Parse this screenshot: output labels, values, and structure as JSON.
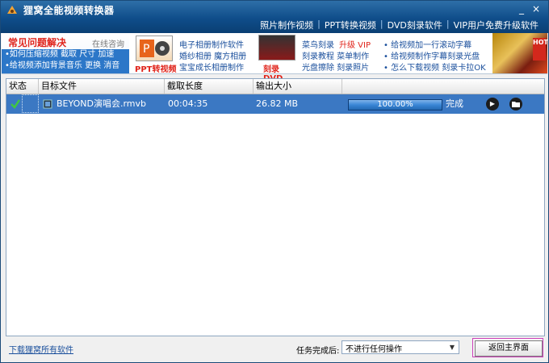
{
  "titlebar": {
    "title": "狸窝全能视频转换器",
    "minimize": "_",
    "close": "×",
    "nav": [
      "照片制作视频",
      "PPT转换视频",
      "DVD刻录软件",
      "VIP用户免费升级软件"
    ]
  },
  "banner": {
    "faq_title": "常见问题解决",
    "faq_online": "在线咨询",
    "faq_line1": "•如何压缩视频  截取  尺寸  加速",
    "faq_line2": "•给视频添加背景音乐  更换  消音",
    "ppt_label": "PPT转视频",
    "album_links": [
      "电子相册制作软件",
      "婚纱相册  魔方相册",
      "宝宝成长相册制作"
    ],
    "dvd_label": "刻录DVD",
    "dvd_link1a": "菜鸟刻录",
    "dvd_link1b": "升级 VIP",
    "dvd_link2": "刻录教程  菜单制作",
    "dvd_link3": "光盘擦除  刻录照片",
    "sub_links": [
      "• 给视频加一行滚动字幕",
      "• 给视频制作字幕刻录光盘",
      "• 怎么下载视频  刻录卡拉OK"
    ],
    "ad_badge": "HOT"
  },
  "table": {
    "headers": [
      "状态",
      "目标文件",
      "截取长度",
      "输出大小"
    ],
    "row": {
      "file": "BEYOND演唱会.rmvb",
      "length": "00:04:35",
      "size": "26.82 MB",
      "progress": 1.0,
      "progress_text": "100.00%",
      "status": "完成"
    }
  },
  "footer": {
    "download_link": "下载狸窝所有软件",
    "after_label": "任务完成后:",
    "after_value": "不进行任何操作",
    "return_button": "返回主界面"
  },
  "colors": {
    "title_bg": "#0f4d8a",
    "row_selected": "#3b78c3",
    "accent_red": "#e0241b",
    "link_blue": "#1a4f9c"
  },
  "icons": [
    "app-fox-icon",
    "checkmark-icon",
    "film-icon",
    "play-icon",
    "folder-icon",
    "dropdown-arrow-icon"
  ]
}
